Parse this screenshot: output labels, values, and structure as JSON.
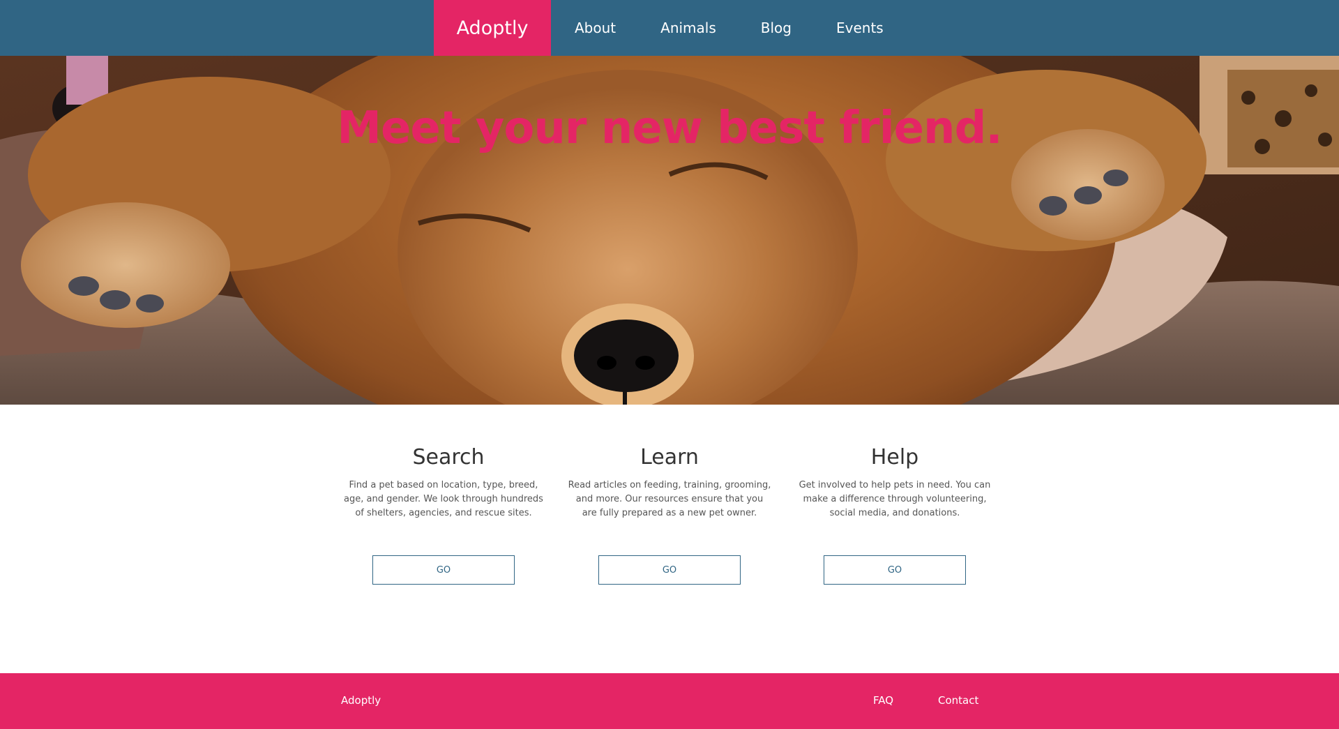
{
  "nav": {
    "brand": "Adoptly",
    "links": [
      "About",
      "Animals",
      "Blog",
      "Events"
    ]
  },
  "hero": {
    "title": "Meet your new best friend.",
    "image": "sleeping-puppy-photo"
  },
  "features": [
    {
      "title": "Search",
      "text": "Find a pet based on location, type, breed, age, and gender. We look through hundreds of shelters, agencies, and rescue sites.",
      "button": "GO"
    },
    {
      "title": "Learn",
      "text": "Read articles on feeding, training, grooming, and more. Our resources ensure that you are fully prepared as a new pet owner.",
      "button": "GO"
    },
    {
      "title": "Help",
      "text": "Get involved to help pets in need. You can make a difference through volunteering, social media, and donations.",
      "button": "GO"
    }
  ],
  "footer": {
    "brand": "Adoptly",
    "links": [
      "FAQ",
      "Contact"
    ]
  },
  "colors": {
    "nav_bg": "#306584",
    "accent": "#e42565",
    "button_border": "#306584"
  }
}
